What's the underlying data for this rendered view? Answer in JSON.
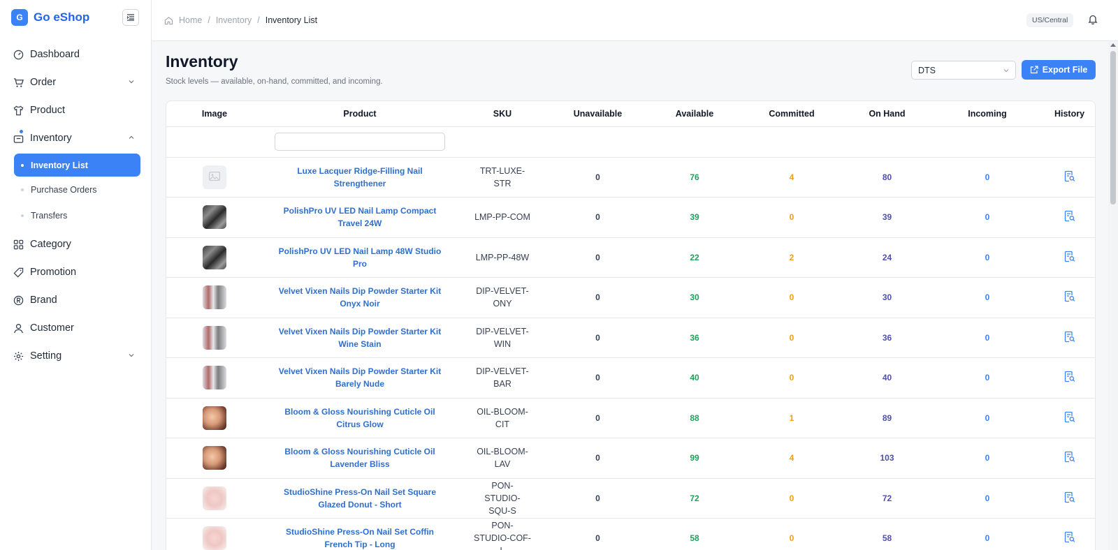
{
  "brand": {
    "logo_letter": "G",
    "name": "Go eShop"
  },
  "sidebar": {
    "items": [
      {
        "label": "Dashboard"
      },
      {
        "label": "Order"
      },
      {
        "label": "Product"
      },
      {
        "label": "Inventory"
      },
      {
        "label": "Category"
      },
      {
        "label": "Promotion"
      },
      {
        "label": "Brand"
      },
      {
        "label": "Customer"
      },
      {
        "label": "Setting"
      }
    ],
    "inventory_sub": [
      {
        "label": "Inventory List"
      },
      {
        "label": "Purchase Orders"
      },
      {
        "label": "Transfers"
      }
    ]
  },
  "breadcrumb": {
    "home": "Home",
    "section": "Inventory",
    "current": "Inventory List",
    "sep": "/"
  },
  "topbar": {
    "timezone": "US/Central"
  },
  "page": {
    "title": "Inventory",
    "subtitle": "Stock levels — available, on-hand, committed, and incoming.",
    "location_select": "DTS",
    "export_label": "Export File"
  },
  "table": {
    "headers": [
      "Image",
      "Product",
      "SKU",
      "Unavailable",
      "Available",
      "Committed",
      "On Hand",
      "Incoming",
      "History"
    ],
    "rows": [
      {
        "thumb": "empty",
        "product": "Luxe Lacquer Ridge-Filling Nail Strengthener",
        "sku": "TRT-LUXE-STR",
        "unavailable": "0",
        "available": "76",
        "committed": "4",
        "on_hand": "80",
        "incoming": "0"
      },
      {
        "thumb": "lamp",
        "product": "PolishPro UV LED Nail Lamp Compact Travel 24W",
        "sku": "LMP-PP-COM",
        "unavailable": "0",
        "available": "39",
        "committed": "0",
        "on_hand": "39",
        "incoming": "0"
      },
      {
        "thumb": "lamp",
        "product": "PolishPro UV LED Nail Lamp 48W Studio Pro",
        "sku": "LMP-PP-48W",
        "unavailable": "0",
        "available": "22",
        "committed": "2",
        "on_hand": "24",
        "incoming": "0"
      },
      {
        "thumb": "dip",
        "product": "Velvet Vixen Nails Dip Powder Starter Kit Onyx Noir",
        "sku": "DIP-VELVET-ONY",
        "unavailable": "0",
        "available": "30",
        "committed": "0",
        "on_hand": "30",
        "incoming": "0"
      },
      {
        "thumb": "dip",
        "product": "Velvet Vixen Nails Dip Powder Starter Kit Wine Stain",
        "sku": "DIP-VELVET-WIN",
        "unavailable": "0",
        "available": "36",
        "committed": "0",
        "on_hand": "36",
        "incoming": "0"
      },
      {
        "thumb": "dip",
        "product": "Velvet Vixen Nails Dip Powder Starter Kit Barely Nude",
        "sku": "DIP-VELVET-BAR",
        "unavailable": "0",
        "available": "40",
        "committed": "0",
        "on_hand": "40",
        "incoming": "0"
      },
      {
        "thumb": "oil",
        "product": "Bloom & Gloss Nourishing Cuticle Oil Citrus Glow",
        "sku": "OIL-BLOOM-CIT",
        "unavailable": "0",
        "available": "88",
        "committed": "1",
        "on_hand": "89",
        "incoming": "0"
      },
      {
        "thumb": "oil",
        "product": "Bloom & Gloss Nourishing Cuticle Oil Lavender Bliss",
        "sku": "OIL-BLOOM-LAV",
        "unavailable": "0",
        "available": "99",
        "committed": "4",
        "on_hand": "103",
        "incoming": "0"
      },
      {
        "thumb": "press",
        "product": "StudioShine Press-On Nail Set Square Glazed Donut - Short",
        "sku": "PON-STUDIO-SQU-S",
        "unavailable": "0",
        "available": "72",
        "committed": "0",
        "on_hand": "72",
        "incoming": "0"
      },
      {
        "thumb": "press",
        "product": "StudioShine Press-On Nail Set Coffin French Tip - Long",
        "sku": "PON-STUDIO-COF-L",
        "unavailable": "0",
        "available": "58",
        "committed": "0",
        "on_hand": "58",
        "incoming": "0"
      }
    ]
  },
  "colors": {
    "accent": "#3b82f6",
    "link": "#2f6fcf",
    "available": "#22a05a",
    "committed": "#f59e0b",
    "on_hand": "#4f4fae",
    "incoming": "#3b82f6"
  }
}
